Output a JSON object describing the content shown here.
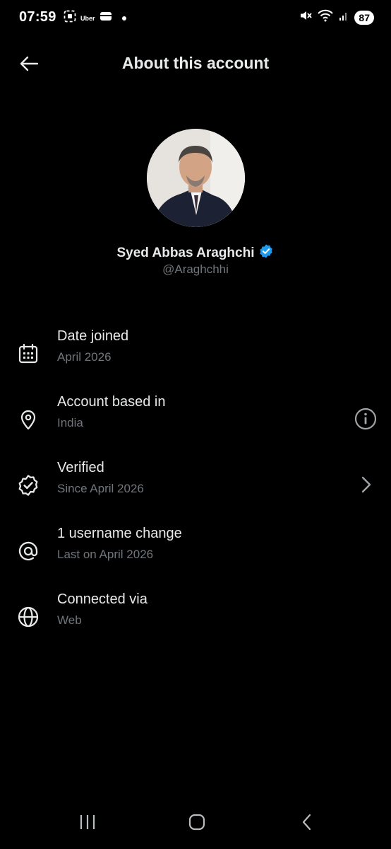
{
  "status_bar": {
    "time": "07:59",
    "uber_label": "Uber",
    "battery": "87"
  },
  "header": {
    "title": "About this account"
  },
  "profile": {
    "name": "Syed Abbas Araghchi",
    "handle": "@Araghchhi",
    "verified_color": "#1d9bf0"
  },
  "items": [
    {
      "icon": "calendar-icon",
      "title": "Date joined",
      "subtitle": "April 2026"
    },
    {
      "icon": "location-pin-icon",
      "title": "Account based in",
      "subtitle": "India",
      "trailing": "info-icon"
    },
    {
      "icon": "verified-badge-icon",
      "title": "Verified",
      "subtitle": "Since April 2026",
      "trailing": "chevron-right-icon"
    },
    {
      "icon": "at-sign-icon",
      "title": "1 username change",
      "subtitle": "Last on April 2026"
    },
    {
      "icon": "globe-icon",
      "title": "Connected via",
      "subtitle": "Web"
    }
  ],
  "colors": {
    "background": "#000000",
    "primary_text": "#e7e9ea",
    "secondary_text": "#71767b"
  }
}
